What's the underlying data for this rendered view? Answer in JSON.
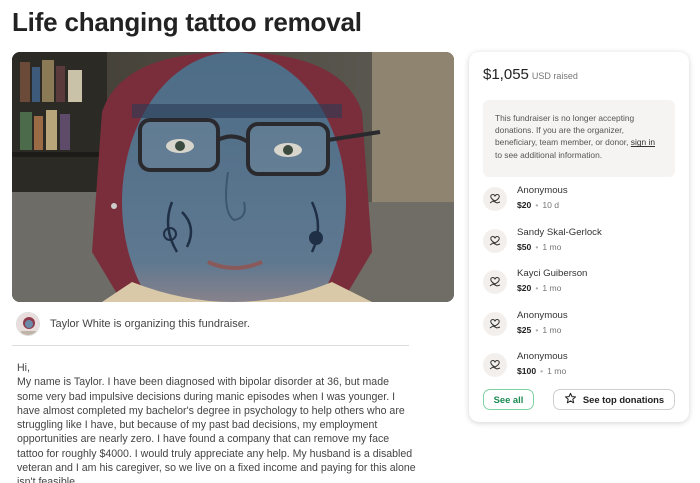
{
  "page": {
    "title": "Life changing tattoo removal"
  },
  "organizer": {
    "text": "Taylor White is organizing this fundraiser."
  },
  "story": {
    "text": "Hi,\nMy name is Taylor. I have been diagnosed with bipolar disorder at 36, but made some very bad impulsive decisions during manic episodes when I was younger. I have almost completed my bachelor's degree in psychology to help others who are struggling like I have, but because of my past bad decisions, my employment opportunities are nearly zero. I have found a company that can remove my face tattoo for roughly $4000. I would truly appreciate any help. My husband is a disabled veteran and I am his caregiver, so we live on a fixed income and paying for this alone isn't feasible."
  },
  "card": {
    "raised_amount": "$1,055",
    "raised_currency": "USD raised",
    "notice_text": "This fundraiser is no longer accepting donations. If you are the organizer, beneficiary, team member, or donor, ",
    "notice_link": "sign in",
    "notice_suffix": " to see additional information.",
    "donations": [
      {
        "name": "Anonymous",
        "amount": "$20",
        "time": "10 d"
      },
      {
        "name": "Sandy Skal-Gerlock",
        "amount": "$50",
        "time": "1 mo"
      },
      {
        "name": "Kayci Guiberson",
        "amount": "$20",
        "time": "1 mo"
      },
      {
        "name": "Anonymous",
        "amount": "$25",
        "time": "1 mo"
      },
      {
        "name": "Anonymous",
        "amount": "$100",
        "time": "1 mo"
      }
    ],
    "see_all_label": "See all",
    "top_donations_label": "See top donations"
  },
  "icons": {
    "donation": "heart-hand-icon",
    "star": "star-icon"
  }
}
